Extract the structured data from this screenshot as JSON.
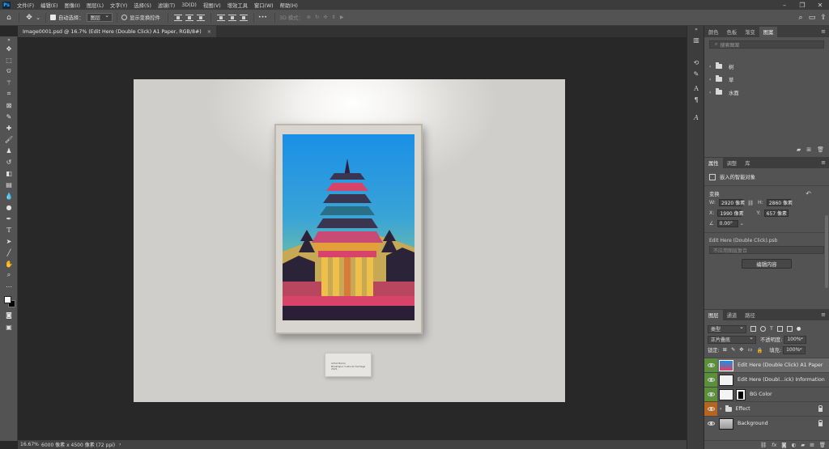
{
  "app": {
    "logo": "Ps"
  },
  "menu": [
    "文件(F)",
    "编辑(E)",
    "图像(I)",
    "图层(L)",
    "文字(Y)",
    "选择(S)",
    "滤镜(T)",
    "3D(D)",
    "视图(V)",
    "增效工具",
    "窗口(W)",
    "帮助(H)"
  ],
  "options_bar": {
    "auto_select_label": "自动选择：",
    "auto_select_value": "图层",
    "show_transform_label": "显示变换控件",
    "more": "•••",
    "mode_label": "3D 模式："
  },
  "document_tab": {
    "title": "Image0001.psd @ 16.7% (Edit Here (Double Click) A1 Paper, RGB/8#)",
    "close": "×"
  },
  "plaque": {
    "line1": "Artist Name",
    "line2": "Bhaktapur Cultural Heritage",
    "line3": "2021"
  },
  "status": {
    "zoom": "16.67%",
    "doc_info": "6000 像素 x 4500 像素 (72 ppi)",
    "chevron": "›"
  },
  "libraries_panel": {
    "tabs": [
      "颜色",
      "色板",
      "渐变",
      "图案"
    ],
    "active_tab": 3,
    "search_placeholder": "搜索图案",
    "groups": [
      "树",
      "草",
      "水面"
    ]
  },
  "properties_panel": {
    "tabs": [
      "属性",
      "调整",
      "库"
    ],
    "active_tab": 0,
    "object_type": "嵌入的智能对象",
    "transform_label": "变换",
    "w_label": "W:",
    "w_value": "2920 像素",
    "h_label": "H:",
    "h_value": "2860 像素",
    "x_label": "X:",
    "x_value": "1990 像素",
    "y_label": "Y:",
    "y_value": "657 像素",
    "angle_value": "0.00°",
    "file_name": "Edit Here (Double Click).psb",
    "comp_placeholder": "不应用图层复合",
    "edit_button": "编辑内容"
  },
  "layers_panel": {
    "tabs": [
      "图层",
      "通道",
      "路径"
    ],
    "active_tab": 0,
    "filter_kind": "类型",
    "blend_mode": "正片叠底",
    "opacity_label": "不透明度:",
    "opacity_value": "100%",
    "lock_label": "锁定:",
    "fill_label": "填充:",
    "fill_value": "100%",
    "layers": [
      {
        "name": "Edit Here (Double Click) A1 Paper",
        "selected": true,
        "thumb": "poster"
      },
      {
        "name": "Edit Here (Doubl...ick) Information",
        "selected": false,
        "thumb": "doc"
      },
      {
        "name": "BG Color",
        "selected": false,
        "thumb": "white-mask"
      },
      {
        "name": "Effect",
        "selected": false,
        "thumb": "folder"
      },
      {
        "name": "Background",
        "selected": false,
        "thumb": "gray"
      }
    ]
  },
  "colors": {
    "eye_green": "#5b8f3a",
    "eye_orange": "#b5651d",
    "accent": "#31a8ff"
  }
}
